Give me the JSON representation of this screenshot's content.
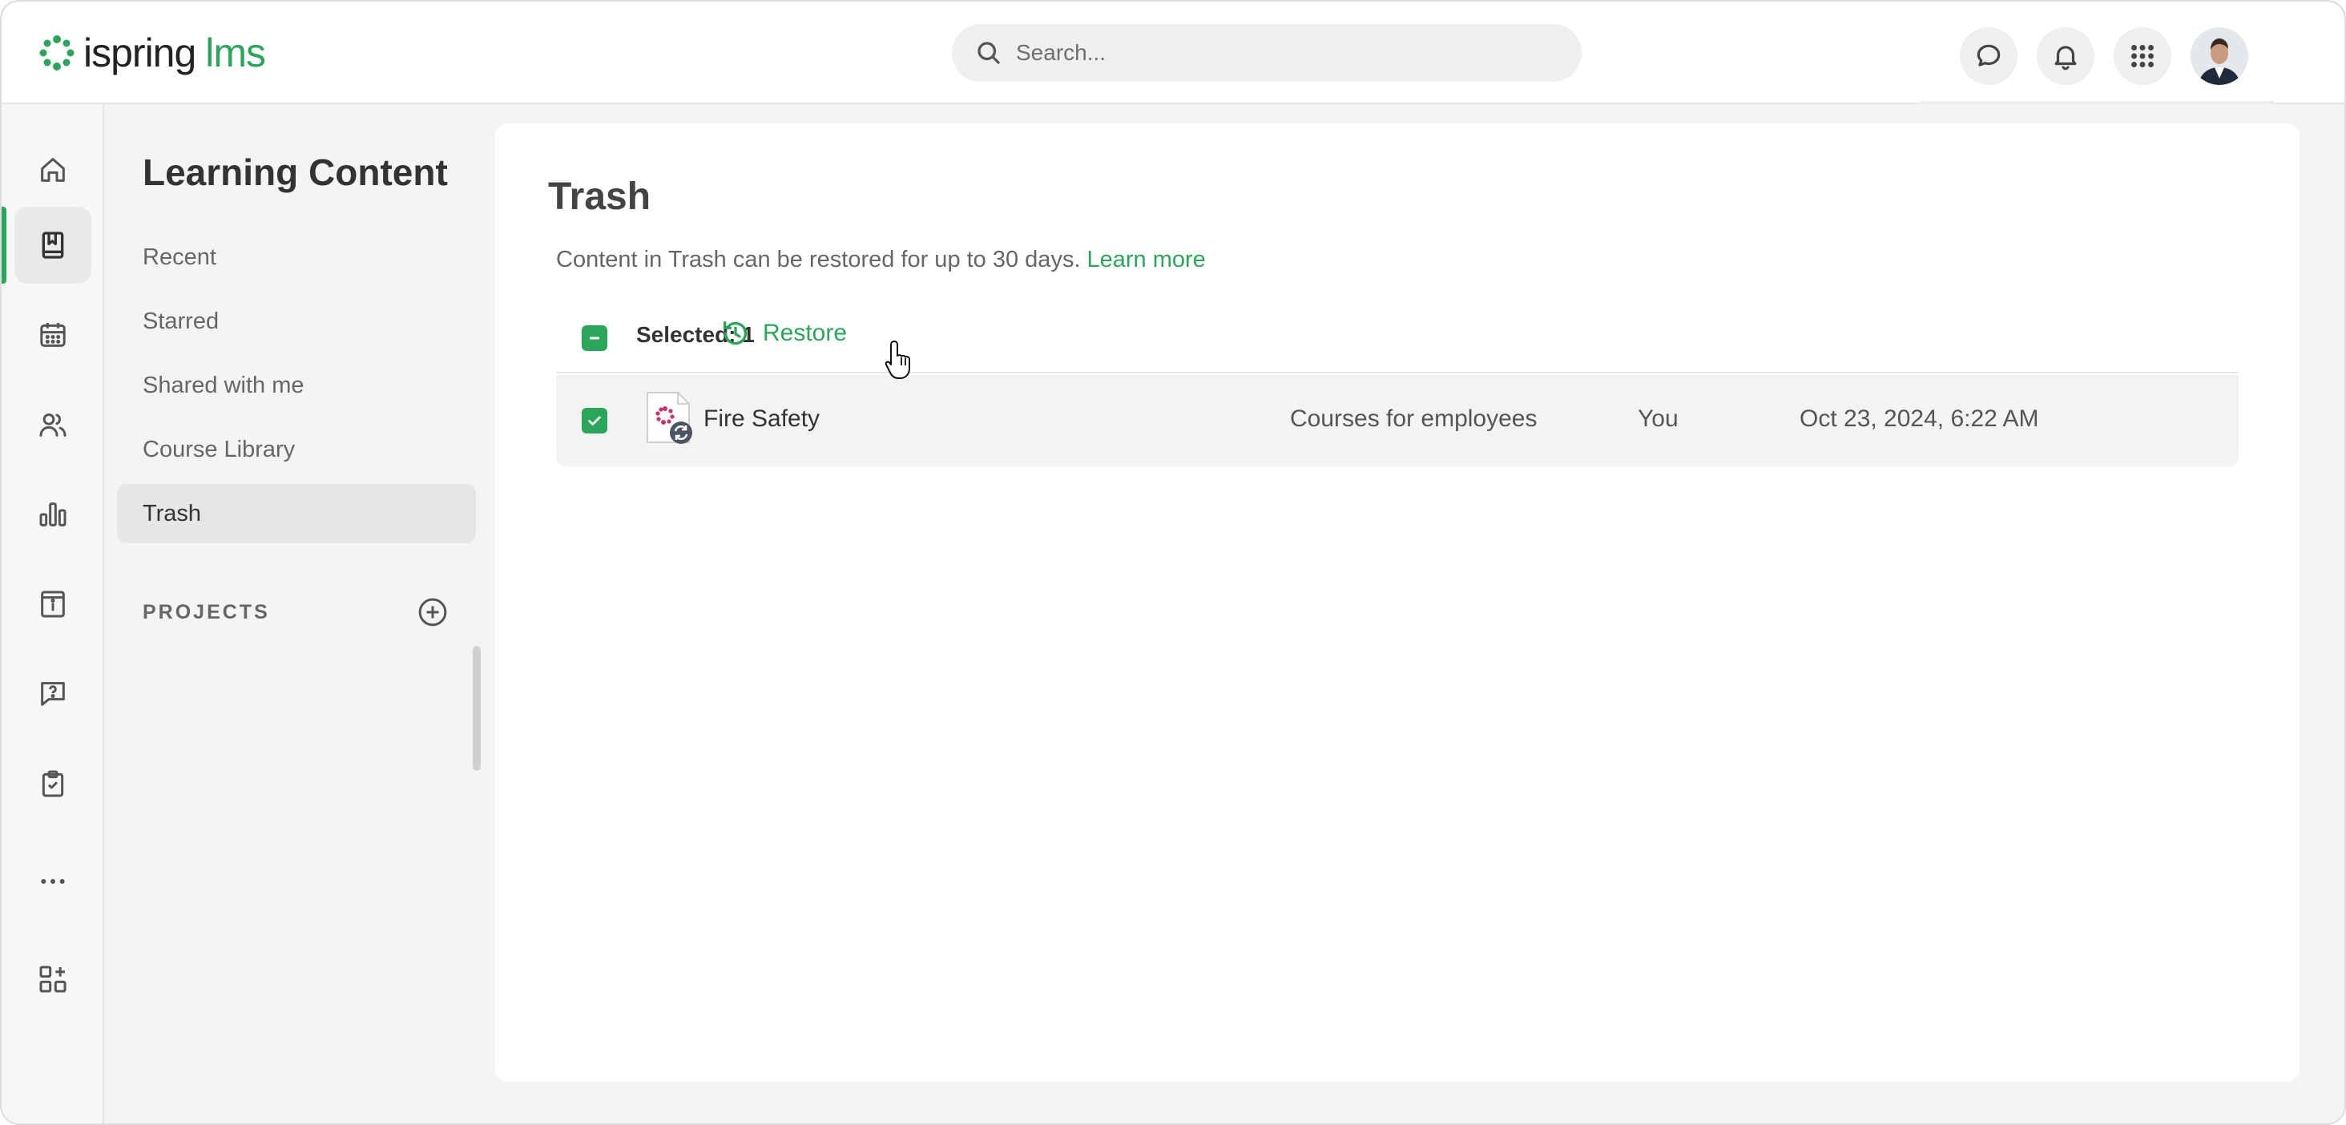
{
  "brand": {
    "name": "ispring",
    "product": "lms",
    "accent_color": "#2aa65a"
  },
  "search": {
    "placeholder": "Search..."
  },
  "header_icons": [
    "chat-icon",
    "bell-icon",
    "apps-grid-icon",
    "user-avatar"
  ],
  "rail_icons": [
    "home-icon",
    "book-icon",
    "calendar-icon",
    "users-icon",
    "bar-chart-icon",
    "info-board-icon",
    "question-chat-icon",
    "clipboard-check-icon",
    "more-icon",
    "add-widget-icon"
  ],
  "sidebar": {
    "title": "Learning Content",
    "items": [
      {
        "label": "Recent"
      },
      {
        "label": "Starred"
      },
      {
        "label": "Shared with me"
      },
      {
        "label": "Course Library"
      },
      {
        "label": "Trash",
        "active": true
      }
    ],
    "projects_label": "PROJECTS"
  },
  "main": {
    "title": "Trash",
    "info_text": "Content in Trash can be restored for up to 30 days.",
    "learn_more": "Learn more",
    "selection": {
      "count_text": "Selected: 1",
      "restore_label": "Restore"
    },
    "rows": [
      {
        "title": "Fire Safety",
        "folder": "Courses for employees",
        "owner": "You",
        "date": "Oct 23, 2024, 6:22 AM",
        "checked": true
      }
    ]
  }
}
